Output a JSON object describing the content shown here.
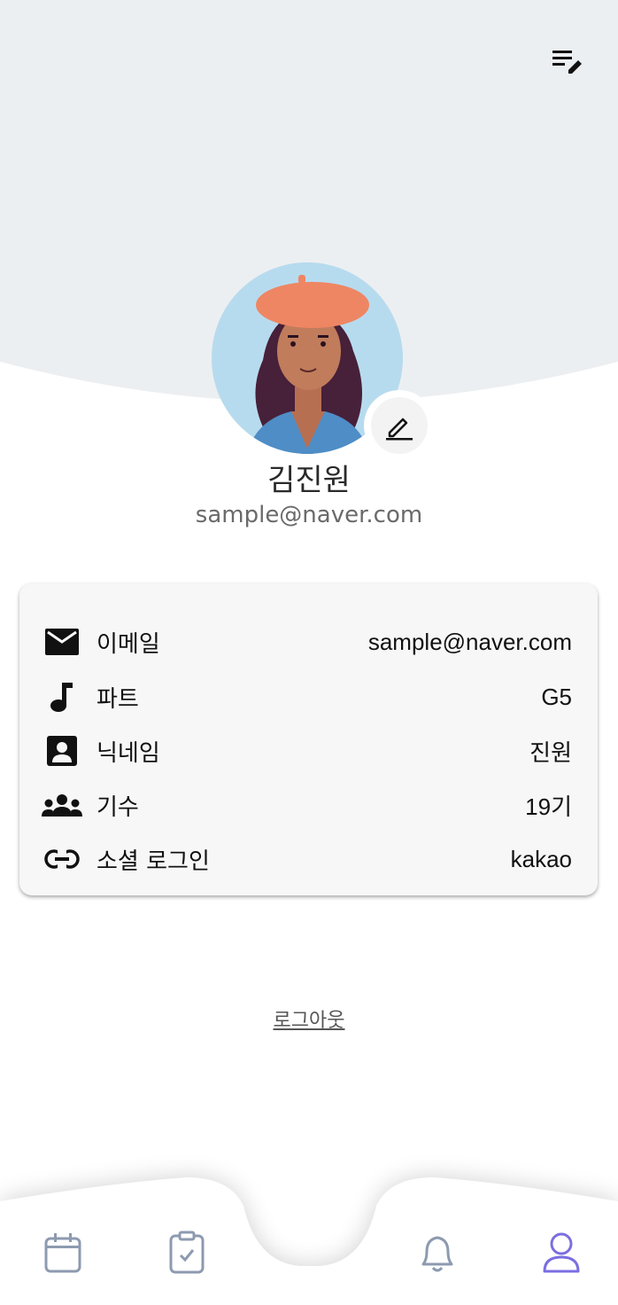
{
  "header": {
    "edit_icon": "list-edit-icon",
    "background_color": "#eceff1"
  },
  "profile": {
    "name": "김진원",
    "email": "sample@naver.com",
    "avatar": "avatar-woman-beret",
    "edit_icon": "pencil-icon"
  },
  "info": {
    "rows": [
      {
        "icon": "mail-icon",
        "label": "이메일",
        "value": "sample@naver.com"
      },
      {
        "icon": "music-note-icon",
        "label": "파트",
        "value": "G5"
      },
      {
        "icon": "contact-card-icon",
        "label": "닉네임",
        "value": "진원"
      },
      {
        "icon": "group-icon",
        "label": "기수",
        "value": "19기"
      },
      {
        "icon": "link-icon",
        "label": "소셜 로그인",
        "value": "kakao"
      }
    ]
  },
  "logout": {
    "label": "로그아웃"
  },
  "tabbar": {
    "active_color": "#7b6ee0",
    "inactive_color": "#8d9ab0",
    "tabs": [
      {
        "icon": "calendar-icon",
        "active": false
      },
      {
        "icon": "clipboard-check-icon",
        "active": false
      },
      {
        "icon": "bell-icon",
        "active": false
      },
      {
        "icon": "person-icon",
        "active": true
      }
    ]
  }
}
